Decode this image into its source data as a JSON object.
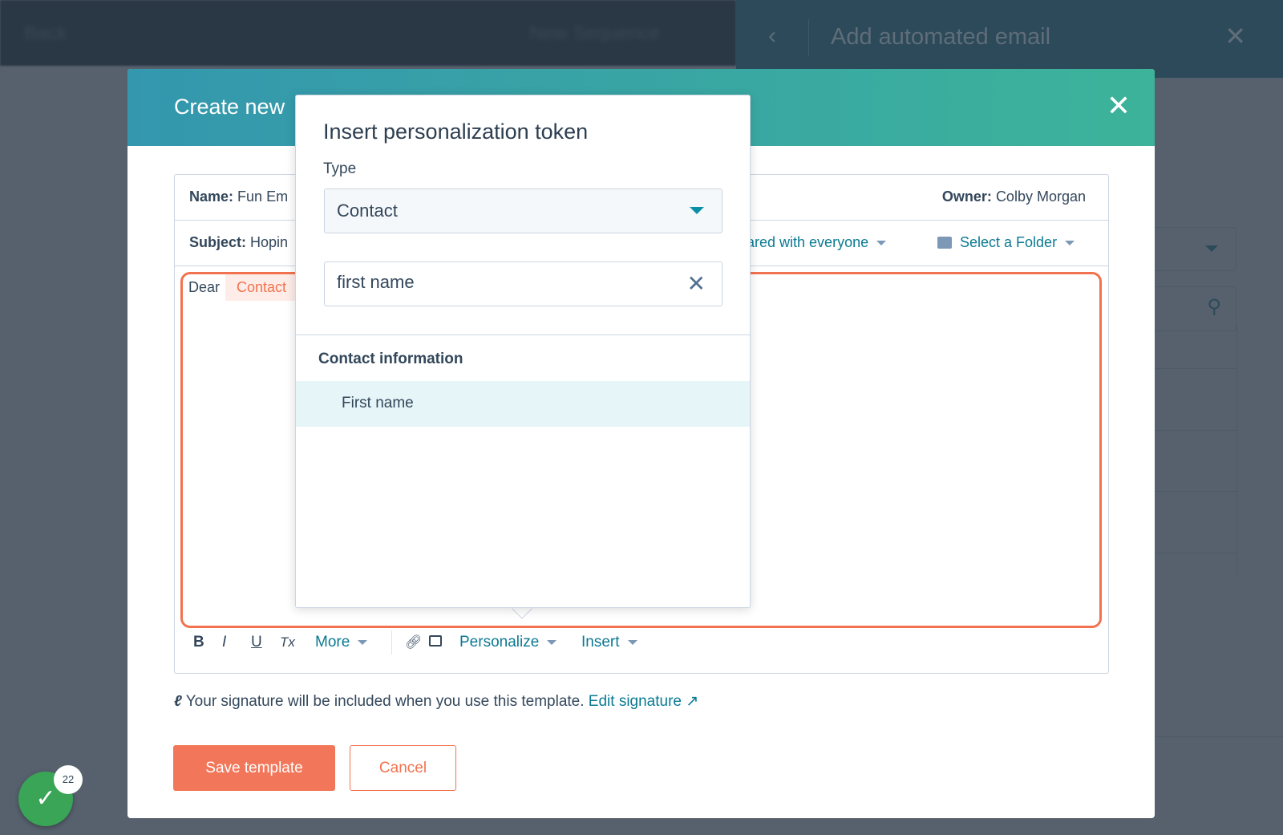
{
  "background": {
    "topbar_left": "Back",
    "topbar_center": "New Sequence",
    "panel": {
      "title": "Add automated email"
    }
  },
  "modal": {
    "title": "Create new",
    "form": {
      "name_label": "Name:",
      "name_value": "Fun Em",
      "owner_label": "Owner:",
      "owner_value": "Colby Morgan",
      "subject_label": "Subject:",
      "subject_value": "Hopin",
      "sharing": "hared with everyone",
      "folder": "Select a Folder",
      "body_text": "Dear",
      "body_token": "Contact"
    },
    "toolbar": {
      "bold": "B",
      "italic": "I",
      "underline": "U",
      "clear": "Tx",
      "more": "More",
      "personalize": "Personalize",
      "insert": "Insert"
    },
    "signature_text": "Your signature will be included when you use this template.",
    "edit_signature": "Edit signature",
    "save": "Save template",
    "cancel": "Cancel"
  },
  "popover": {
    "title": "Insert personalization token",
    "type_label": "Type",
    "type_value": "Contact",
    "search_value": "first name",
    "section": "Contact information",
    "options": [
      "First name"
    ]
  },
  "notification": {
    "count": "22"
  },
  "colors": {
    "accent": "#f2724f",
    "link": "#0b7a93",
    "header_start": "#3497ae",
    "header_end": "#3db39a",
    "success": "#3aa556"
  }
}
